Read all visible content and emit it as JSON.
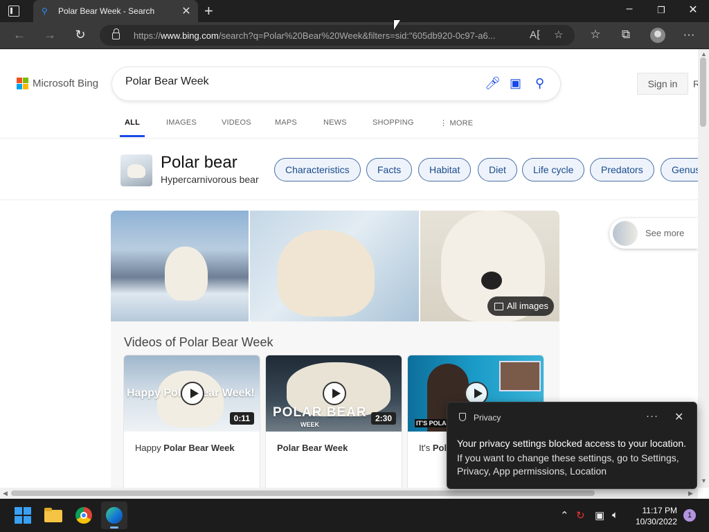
{
  "browser": {
    "tab_title": "Polar Bear Week - Search",
    "url_prefix": "https://",
    "url_host": "www.bing.com",
    "url_rest": "/search?q=Polar%20Bear%20Week&filters=sid:\"605db920-0c97-a6..."
  },
  "bing": {
    "logo_text": "Microsoft Bing",
    "search_value": "Polar Bear Week",
    "signin_label": "Sign in",
    "edge_text": "R",
    "nav": [
      "ALL",
      "IMAGES",
      "VIDEOS",
      "MAPS",
      "NEWS",
      "SHOPPING",
      "MORE"
    ],
    "entity_title": "Polar bear",
    "entity_subtitle": "Hypercarnivorous bear",
    "chips": [
      "Characteristics",
      "Facts",
      "Habitat",
      "Diet",
      "Life cycle",
      "Predators",
      "Genus"
    ],
    "all_images_label": "All images",
    "see_more_label": "See more",
    "videos_title": "Videos of Polar Bear Week",
    "videos": [
      {
        "duration": "0:11",
        "label_pre": "Happy ",
        "label_bold": "Polar Bear Week",
        "thumb_text": "Happy Polar Bear Week!"
      },
      {
        "duration": "2:30",
        "label_pre": "",
        "label_bold": "Polar Bear Week",
        "thumb_text": "POLAR BEAR",
        "thumb_sub": "WEEK"
      },
      {
        "duration": "",
        "label_pre": "It's ",
        "label_bold": "Pola",
        "thumb_text": "IT'S POLAR"
      }
    ]
  },
  "toast": {
    "heading": "Privacy",
    "more": "···",
    "message": "Your privacy settings blocked access to your location.",
    "detail": "If you want to change these settings, go to Settings, Privacy, App permissions, Location"
  },
  "taskbar": {
    "time": "11:17 PM",
    "date": "10/30/2022",
    "notifications": "1"
  },
  "colors": {
    "accent": "#174ae4",
    "chip_border": "#4a6fa5",
    "chip_bg": "#eef3fb"
  }
}
